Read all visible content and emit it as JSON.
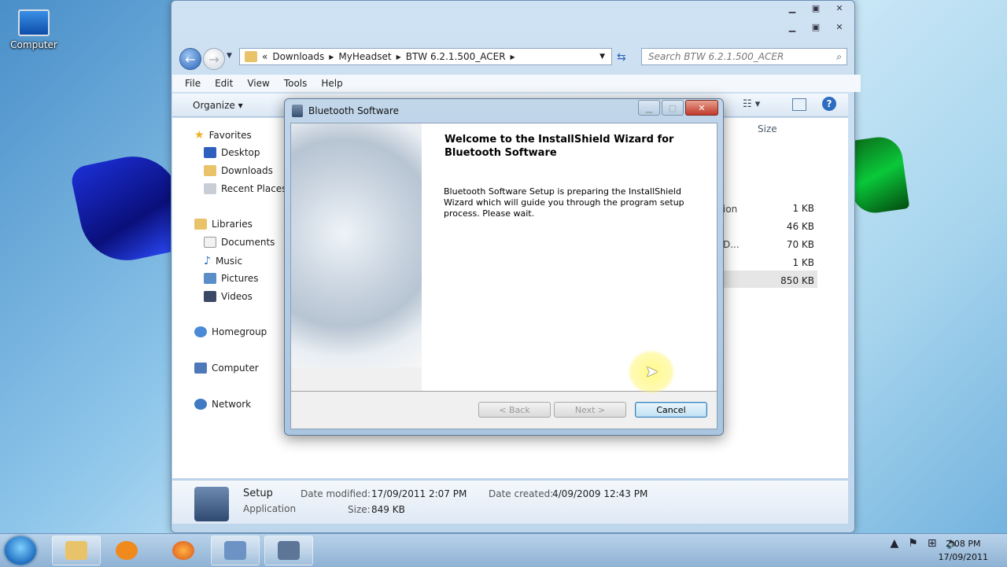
{
  "desktop": {
    "icon_label": "Computer"
  },
  "explorer": {
    "breadcrumb": [
      "«",
      "Downloads",
      "MyHeadset",
      "BTW 6.2.1.500_ACER"
    ],
    "search_placeholder": "Search BTW 6.2.1.500_ACER",
    "menu": [
      "File",
      "Edit",
      "View",
      "Tools",
      "Help"
    ],
    "organize_label": "Organize",
    "column_size": "Size",
    "nav": {
      "favorites": "Favorites",
      "desktop": "Desktop",
      "downloads": "Downloads",
      "recent": "Recent Places",
      "libraries": "Libraries",
      "documents": "Documents",
      "music": "Music",
      "pictures": "Pictures",
      "videos": "Videos",
      "homegroup": "Homegroup",
      "computer": "Computer",
      "network": "Network"
    },
    "file_fragments": [
      "ion",
      "D..."
    ],
    "sizes": [
      "1 KB",
      "46 KB",
      "70 KB",
      "1 KB",
      "850 KB"
    ],
    "details": {
      "name": "Setup",
      "type": "Application",
      "date_modified_label": "Date modified:",
      "date_modified": "17/09/2011 2:07 PM",
      "date_created_label": "Date created:",
      "date_created": "4/09/2009 12:43 PM",
      "size_label": "Size:",
      "size": "849 KB"
    }
  },
  "dialog": {
    "title": "Bluetooth Software",
    "heading": "Welcome to the InstallShield Wizard for Bluetooth Software",
    "body": "Bluetooth Software Setup is preparing the InstallShield Wizard which will guide you through the program setup process. Please wait.",
    "back_label": "< Back",
    "next_label": "Next >",
    "cancel_label": "Cancel"
  },
  "taskbar": {
    "time": "2:08 PM",
    "date": "17/09/2011"
  }
}
